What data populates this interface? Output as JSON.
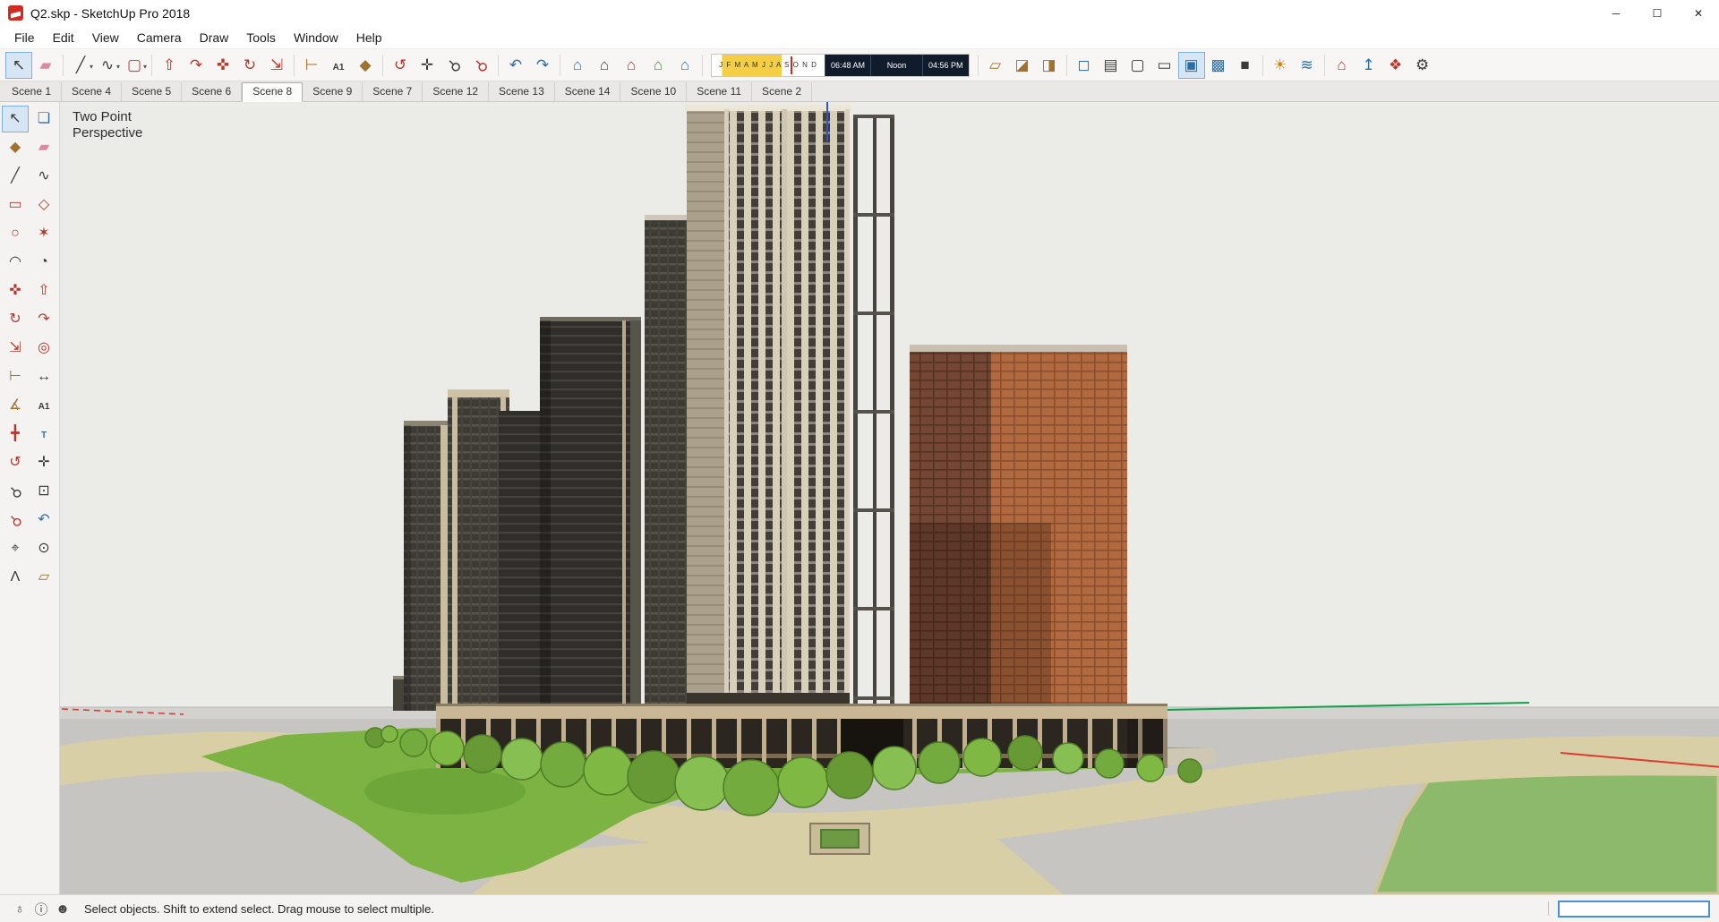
{
  "window": {
    "title": "Q2.skp - SketchUp Pro 2018",
    "controls": {
      "minimize": "─",
      "maximize": "☐",
      "close": "✕"
    }
  },
  "menus": [
    {
      "label": "File"
    },
    {
      "label": "Edit"
    },
    {
      "label": "View"
    },
    {
      "label": "Camera"
    },
    {
      "label": "Draw"
    },
    {
      "label": "Tools"
    },
    {
      "label": "Window"
    },
    {
      "label": "Help"
    }
  ],
  "icons": {
    "select": "↖",
    "make_component": "❏",
    "paint_bucket": "◆",
    "eraser": "▰",
    "line": "╱",
    "freehand": "∿",
    "shapes": "▢",
    "rectangle": "▭",
    "rotated_rectangle": "◇",
    "circle": "○",
    "polygon": "✶",
    "arc": "◠",
    "pie": "◔",
    "move": "✜",
    "push_pull": "⇧",
    "rotate": "↻",
    "follow_me": "↷",
    "scale": "⇲",
    "offset": "◎",
    "tape_measure": "⊢",
    "dimension": "↔",
    "protractor": "∡",
    "text": "A1",
    "axes": "╋",
    "three_d_text": "T",
    "orbit": "↺",
    "pan": "✛",
    "zoom": "⚲",
    "zoom_window": "⊡",
    "zoom_extents": "⚲",
    "previous": "↶",
    "next": "↷",
    "position_camera": "⌖",
    "look_around": "⊙",
    "walk": "Λ",
    "section_plane": "▱",
    "section_fill": "◪",
    "section_display": "◨",
    "iso_view": "⌂",
    "top_view": "⌂",
    "front_view": "⌂",
    "right_view": "⌂",
    "back_view": "⌂",
    "x_ray": "◻",
    "back_edges": "▤",
    "wireframe": "▢",
    "hidden_line": "▭",
    "shaded": "▣",
    "shaded_textures": "▩",
    "monochrome": "■",
    "shadows_toggle": "☀",
    "fog": "≋",
    "get_models": "⌂",
    "share_model": "↥",
    "extension_warehouse": "❖",
    "preferences": "⚙",
    "dropdown": "▾",
    "globe": "♁",
    "info": "ⓘ",
    "person": "☻"
  },
  "shadow": {
    "months": "J F M A M J J A S O N D",
    "start": "06:48 AM",
    "noon": "Noon",
    "end": "04:56 PM"
  },
  "scenes": [
    "Scene 1",
    "Scene 4",
    "Scene 5",
    "Scene 6",
    "Scene 8",
    "Scene 9",
    "Scene 7",
    "Scene 12",
    "Scene 13",
    "Scene 14",
    "Scene 10",
    "Scene 11",
    "Scene 2"
  ],
  "active_scene": "Scene 8",
  "viewport": {
    "label_line1": "Two Point",
    "label_line2": "Perspective"
  },
  "statusbar": {
    "message": "Select objects. Shift to extend select. Drag mouse to select multiple.",
    "measurements_value": ""
  },
  "colors": {
    "sky": "#ebebe8",
    "ground": "#c6c5c2",
    "grass": "#7cb342",
    "road": "#d9cfa6",
    "brick": "#b16a40",
    "tower_beige": "#d9d0bb",
    "tower_dark": "#3d3b36",
    "selection_blue": "#4a90d9",
    "axis_green": "#12a14b",
    "axis_red": "#e03a2e",
    "axis_blue": "#3056c8"
  }
}
